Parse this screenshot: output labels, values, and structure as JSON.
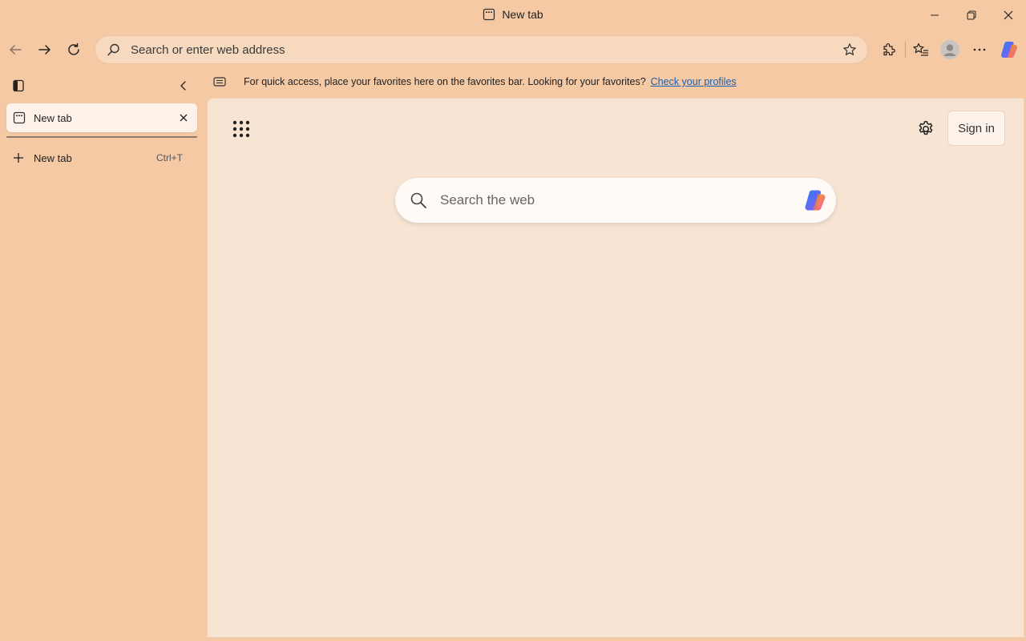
{
  "window": {
    "title": "New tab"
  },
  "toolbar": {
    "address_placeholder": "Search or enter web address"
  },
  "sidebar": {
    "tabs": [
      {
        "label": "New tab",
        "active": true
      }
    ],
    "new_tab": {
      "label": "New tab",
      "shortcut": "Ctrl+T"
    }
  },
  "favorites_bar": {
    "message": "For quick access, place your favorites here on the favorites bar. Looking for your favorites?",
    "link": "Check your profiles"
  },
  "new_tab_page": {
    "sign_in_label": "Sign in",
    "search_placeholder": "Search the web"
  },
  "colors": {
    "frame": "#f4c9a4",
    "content": "#f8e4d3",
    "link": "#1a5fb4"
  }
}
